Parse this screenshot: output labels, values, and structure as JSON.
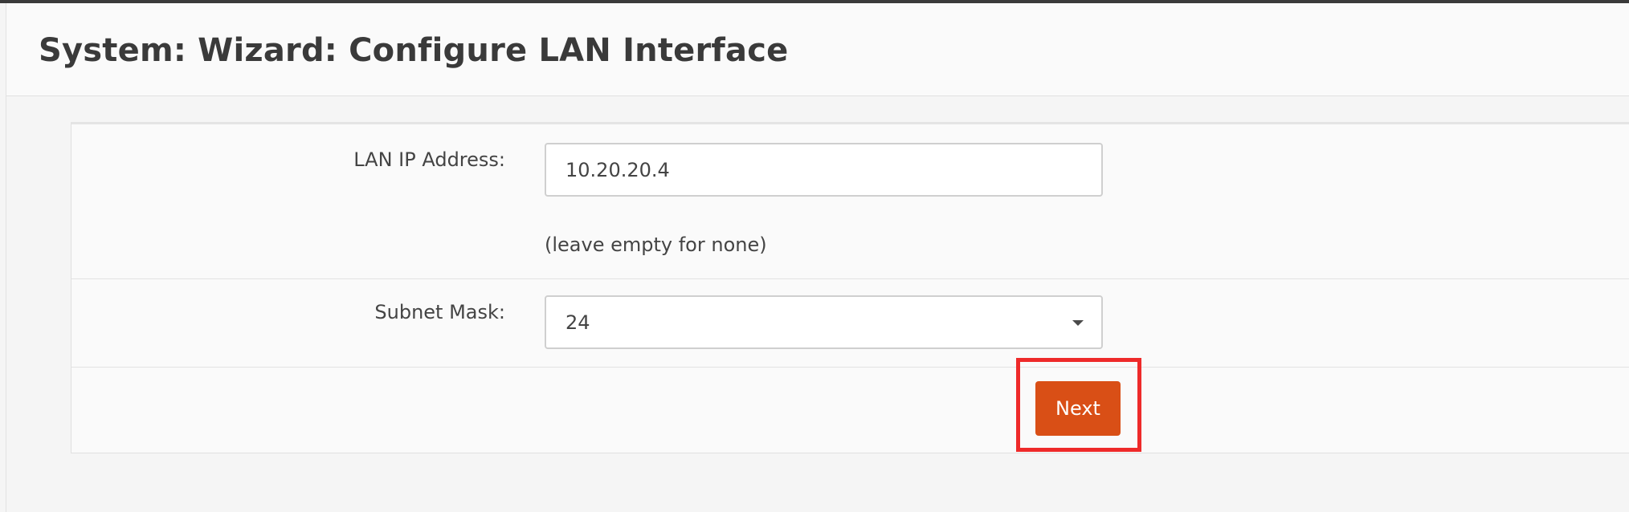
{
  "header": {
    "title": "System: Wizard: Configure LAN Interface"
  },
  "form": {
    "lan_ip": {
      "label": "LAN IP Address:",
      "value": "10.20.20.4",
      "hint": "(leave empty for none)"
    },
    "subnet_mask": {
      "label": "Subnet Mask:",
      "selected": "24"
    },
    "next_label": "Next"
  },
  "colors": {
    "primary_button": "#d94f16",
    "highlight": "#ee2a2a"
  },
  "icons": {
    "select_caret": "caret-down-icon"
  }
}
